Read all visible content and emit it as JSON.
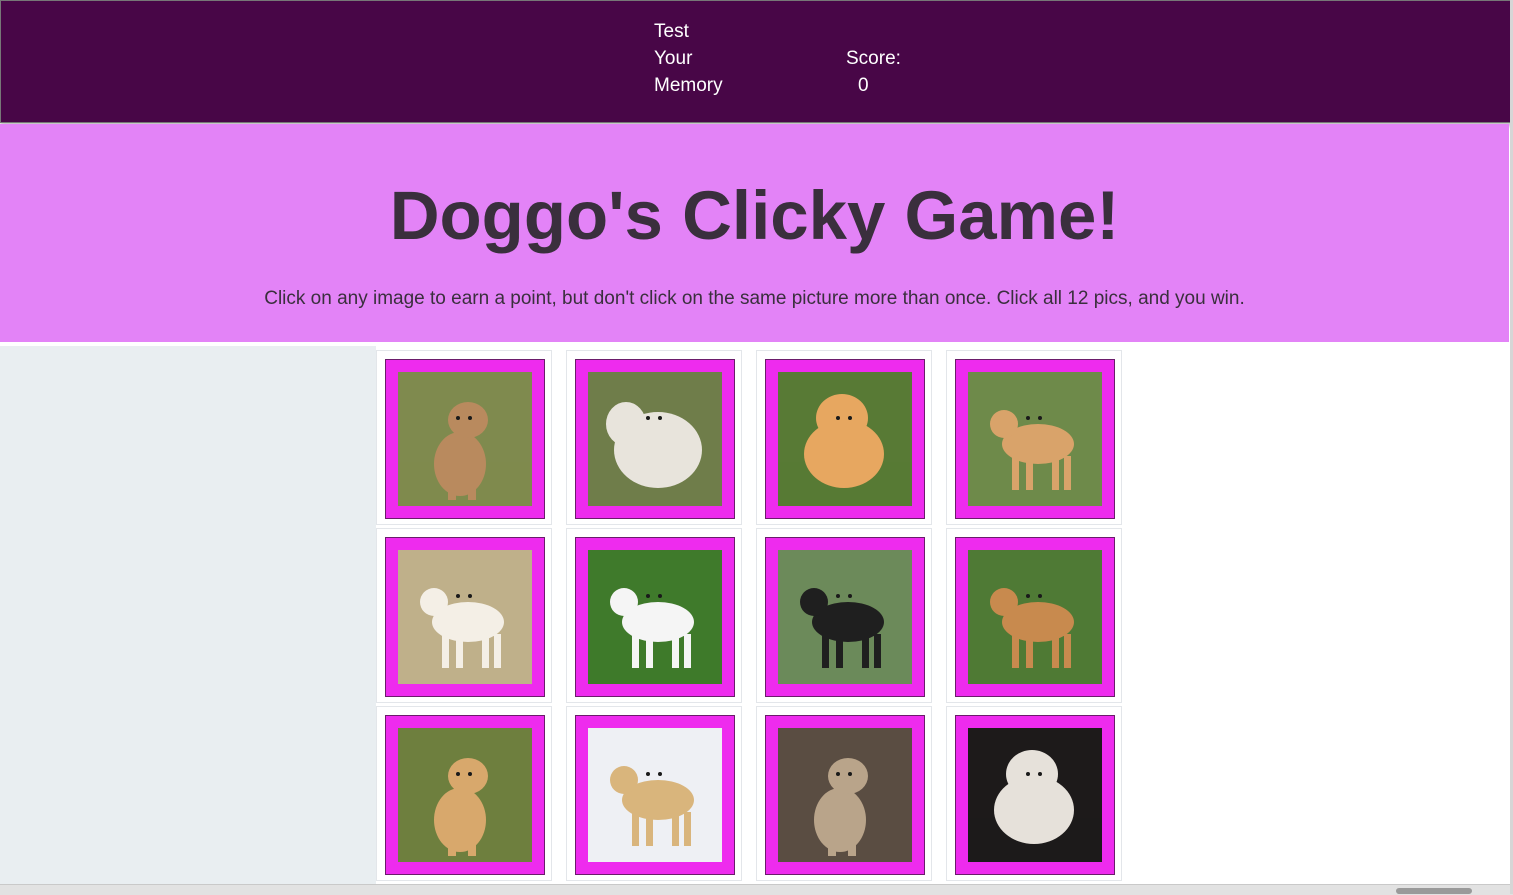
{
  "navbar": {
    "brand_lines": [
      "Test",
      "Your",
      "Memory"
    ],
    "score_label": "Score:",
    "score_value": "0"
  },
  "header": {
    "title": "Doggo's Clicky Game!",
    "instructions": "Click on any image to earn a point, but don't click on the same picture more than once. Click all 12 pics, and you win."
  },
  "colors": {
    "navbar_bg": "#480647",
    "jumbotron_bg": "#e383f7",
    "card_frame": "#ee2bee"
  },
  "cards": [
    {
      "name": "shar-pei",
      "bg": "#7f8a4e",
      "dog": "#b98a5e",
      "pose": "sit"
    },
    {
      "name": "komondor",
      "bg": "#6f7d4a",
      "dog": "#e8e4dc",
      "pose": "mop"
    },
    {
      "name": "pomeranian",
      "bg": "#587a35",
      "dog": "#e7a760",
      "pose": "fluff"
    },
    {
      "name": "pekingese",
      "bg": "#6e8a4a",
      "dog": "#d9a36a",
      "pose": "stand"
    },
    {
      "name": "brittany",
      "bg": "#bfb08a",
      "dog": "#f4efe6",
      "pose": "stand"
    },
    {
      "name": "bull-terrier",
      "bg": "#3f7a2b",
      "dog": "#f5f5f5",
      "pose": "stand"
    },
    {
      "name": "border-collie",
      "bg": "#6c8a5a",
      "dog": "#1f1f1f",
      "pose": "stand"
    },
    {
      "name": "bulldog",
      "bg": "#4f7a35",
      "dog": "#c88a4e",
      "pose": "stand"
    },
    {
      "name": "golden-retriever-puppy",
      "bg": "#6e7f3e",
      "dog": "#d8a86c",
      "pose": "sit"
    },
    {
      "name": "labrador-in-snow",
      "bg": "#eef0f4",
      "dog": "#d9b57c",
      "pose": "stand"
    },
    {
      "name": "yorkshire-terrier",
      "bg": "#5a4d42",
      "dog": "#b9a48a",
      "pose": "sit"
    },
    {
      "name": "havanese",
      "bg": "#1d1a1a",
      "dog": "#e6e1da",
      "pose": "fluff"
    }
  ]
}
